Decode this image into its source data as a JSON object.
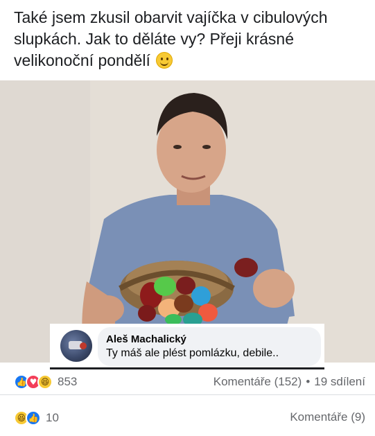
{
  "post": {
    "line1": "Také jsem zkusil obarvit vajíčka v cibulových",
    "line2": "slupkách. Jak to děláte vy? Přeji krásné",
    "line3": "velikonoční pondělí",
    "emoji": "smiling-face-icon"
  },
  "comment": {
    "author": "Aleš Machalický",
    "text": "Ty máš ale plést pomlázku, debile.."
  },
  "stats": {
    "reaction_count": "853",
    "comments": "Komentáře (152)",
    "separator": "•",
    "shares": "19 sdílení"
  },
  "stats2": {
    "reaction_count": "10",
    "comments": "Komentáře (9)"
  },
  "icons": {
    "like": "👍",
    "love": "♥",
    "haha": "😆"
  }
}
